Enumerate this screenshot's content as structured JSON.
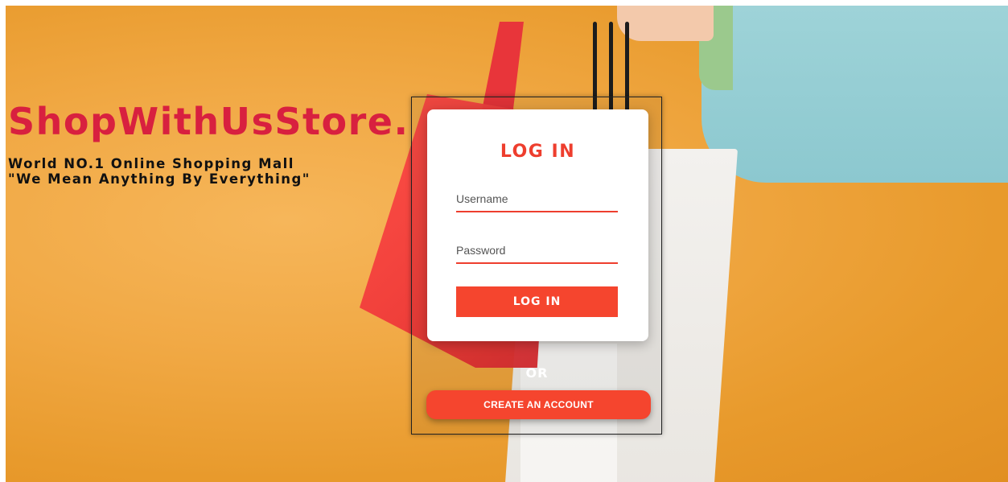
{
  "brand": {
    "name": "ShopWithUsStore.",
    "tagline_line1": "World NO.1 Online Shopping Mall",
    "tagline_line2": "\"We Mean Anything By Everything\""
  },
  "login": {
    "title": "LOG IN",
    "username_placeholder": "Username",
    "password_placeholder": "Password",
    "login_button": "LOG IN"
  },
  "divider_text": "OR",
  "create_account_button": "CREATE AN ACCOUNT",
  "colors": {
    "brand": "#d8203f",
    "accent": "#f5452e",
    "background": "#f1a945"
  }
}
